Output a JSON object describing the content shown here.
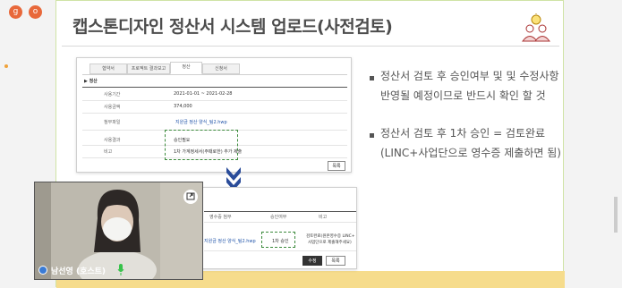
{
  "top_icons": [
    "g",
    "o"
  ],
  "slide": {
    "title": "캡스톤디자인 정산서 시스템 업로드(사전검토)",
    "bullets": [
      {
        "line1": "정산서 검토 후 승인여부 및 및 수정사항",
        "line2": "반영될 예정이므로 반드시 확인 할 것"
      },
      {
        "line1": "정산서 검토 후 1차 승인 = 검토완료",
        "line2": "(LINC+사업단으로 영수증 제출하면 됨)"
      }
    ]
  },
  "upper_screenshot": {
    "tabs": [
      "협약서",
      "프로젝트 결과보고",
      "정산",
      "신청서"
    ],
    "section_heading": "▶ 정산",
    "rows": [
      {
        "label": "사용기간",
        "value": "2021-01-01 ~ 2021-02-28"
      },
      {
        "label": "사용금액",
        "value": "374,000"
      },
      {
        "label": "첨부파일",
        "value": "지원금 정산 양식_팀2.hwp"
      },
      {
        "label": "사용결과",
        "value": "승인필요"
      },
      {
        "label": "비고",
        "value": "1차 가계정세서(주때로한) 추가 제출"
      }
    ],
    "button": "목록"
  },
  "lower_screenshot": {
    "headers": [
      "영수증 첨부",
      "승인여부",
      "비고"
    ],
    "row": {
      "file": "지원금 정산 양식_팀2.hwp",
      "status": "1차 승인",
      "note_line1": "검토완료(원본영수증 LINC+",
      "note_line2": "사업단으로 제출해주세요)"
    },
    "buttons": [
      "수정",
      "목록"
    ]
  },
  "video": {
    "participant_name": "남선영 (호스트)"
  }
}
